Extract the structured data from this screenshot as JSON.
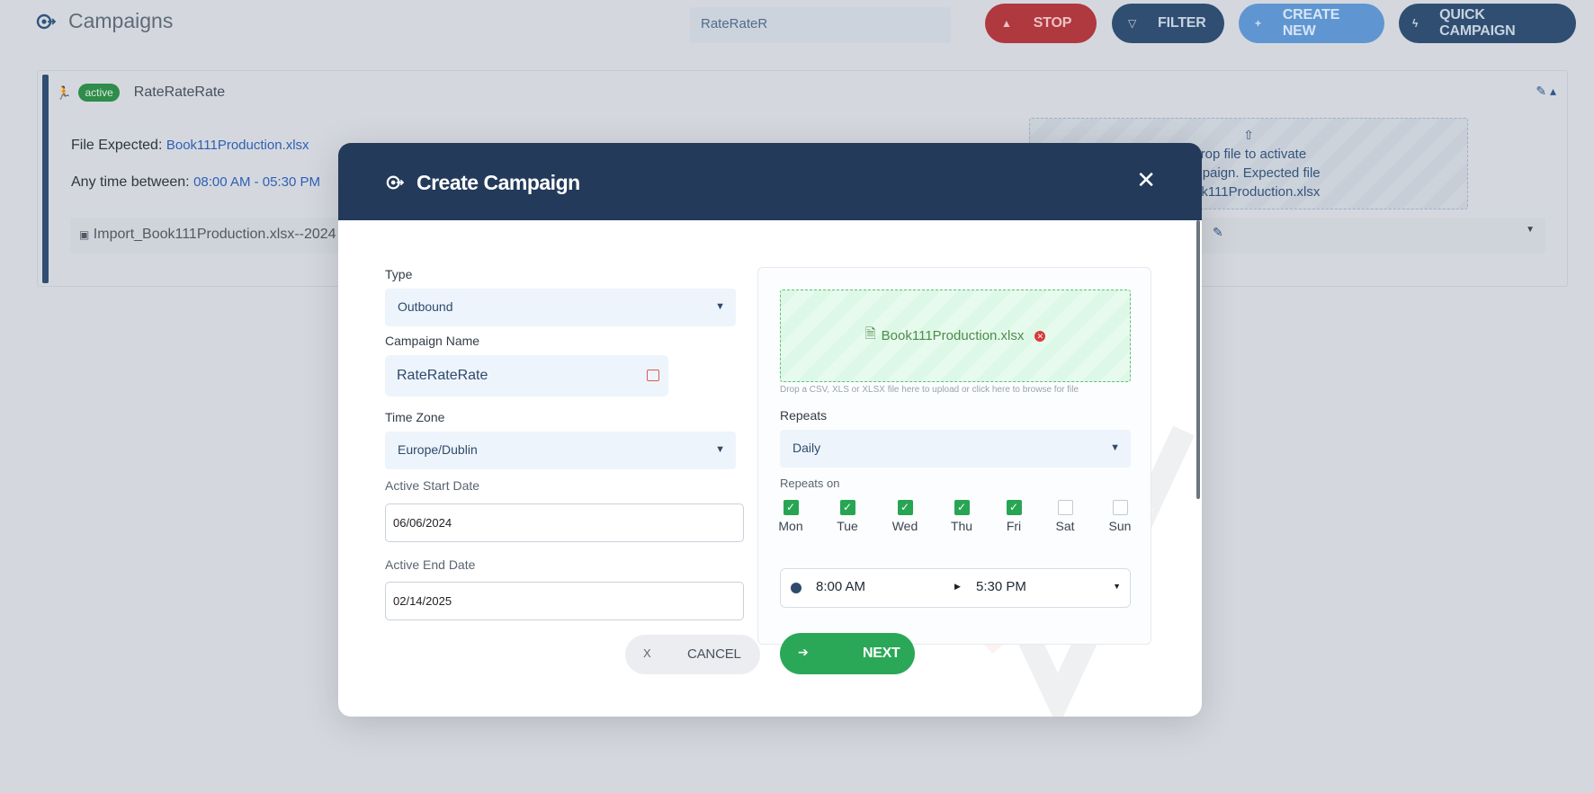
{
  "header": {
    "title": "Campaigns",
    "search_value": "RateRateR",
    "buttons": {
      "stop": "STOP",
      "filter": "FILTER",
      "create_new": "CREATE NEW",
      "quick_campaign": "QUICK CAMPAIGN"
    }
  },
  "campaign_card": {
    "status_badge": "active",
    "name": "RateRateRate",
    "file_expected_label": "File Expected:",
    "file_expected_value": "Book111Production.xlsx",
    "time_label": "Any time between:",
    "time_value": "08:00 AM - 05:30 PM",
    "import_name": "Import_Book111Production.xlsx--2024",
    "drop_text": "Drop file to activate campaign. Expected file Book111Production.xlsx"
  },
  "modal": {
    "title": "Create Campaign",
    "type_label": "Type",
    "type_value": "Outbound",
    "campaign_name_label": "Campaign Name",
    "campaign_name_value": "RateRateRate",
    "timezone_label": "Time Zone",
    "timezone_value": "Europe/Dublin",
    "start_date_label": "Active Start Date",
    "start_date_value": "06/06/2024",
    "end_date_label": "Active End Date",
    "end_date_value": "02/14/2025",
    "upload_file_name": "Book111Production.xlsx",
    "upload_hint": "Drop a CSV, XLS or XLSX file here to upload or click here to browse for file",
    "repeats_label": "Repeats",
    "repeats_value": "Daily",
    "repeats_on_label": "Repeats on",
    "days": [
      {
        "name": "Mon",
        "checked": true
      },
      {
        "name": "Tue",
        "checked": true
      },
      {
        "name": "Wed",
        "checked": true
      },
      {
        "name": "Thu",
        "checked": true
      },
      {
        "name": "Fri",
        "checked": true
      },
      {
        "name": "Sat",
        "checked": false
      },
      {
        "name": "Sun",
        "checked": false
      }
    ],
    "start_time": "8:00 AM",
    "end_time": "5:30 PM",
    "cancel_icon": "X",
    "cancel_label": "CANCEL",
    "next_label": "NEXT"
  },
  "colors": {
    "navy": "#233a5a",
    "green": "#2aa857",
    "stop_red": "#b0383f",
    "create_blue": "#5f96d2"
  }
}
